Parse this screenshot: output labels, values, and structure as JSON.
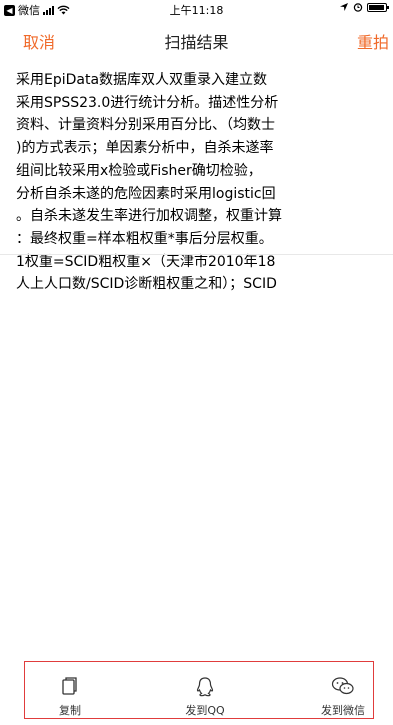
{
  "status_bar": {
    "back_app": "微信",
    "time": "上午11:18"
  },
  "nav": {
    "cancel_label": "取消",
    "title": "扫描结果",
    "retake_label": "重拍"
  },
  "content": {
    "lines": [
      "采用EpiData数据库双人双重录入建立数",
      "采用SPSS23.0进行统计分析。描述性分析",
      "资料、计量资料分别采用百分比、（均数士",
      ")的方式表示；单因素分析中，自杀未遂率",
      "组间比较采用x检验或Fisher确切检验，",
      "分析自杀未遂的危险因素时采用logistic回",
      "。自杀未遂发生率进行加权调整，权重计算",
      "：最终权重=样本粗权重*事后分层权重。",
      "1权重=SCID粗权重×（天津市2010年18",
      "人上人口数/SCID诊断粗权重之和）；SCID"
    ]
  },
  "toolbar": {
    "copy_label": "复制",
    "qq_label": "发到QQ",
    "wechat_label": "发到微信"
  },
  "colors": {
    "accent": "#f06a2a",
    "highlight_border": "#e03c3c"
  },
  "icons": [
    "back-icon",
    "signal-icon",
    "wifi-icon",
    "location-icon",
    "alarm-icon",
    "battery-icon",
    "copy-icon",
    "qq-icon",
    "wechat-icon"
  ]
}
